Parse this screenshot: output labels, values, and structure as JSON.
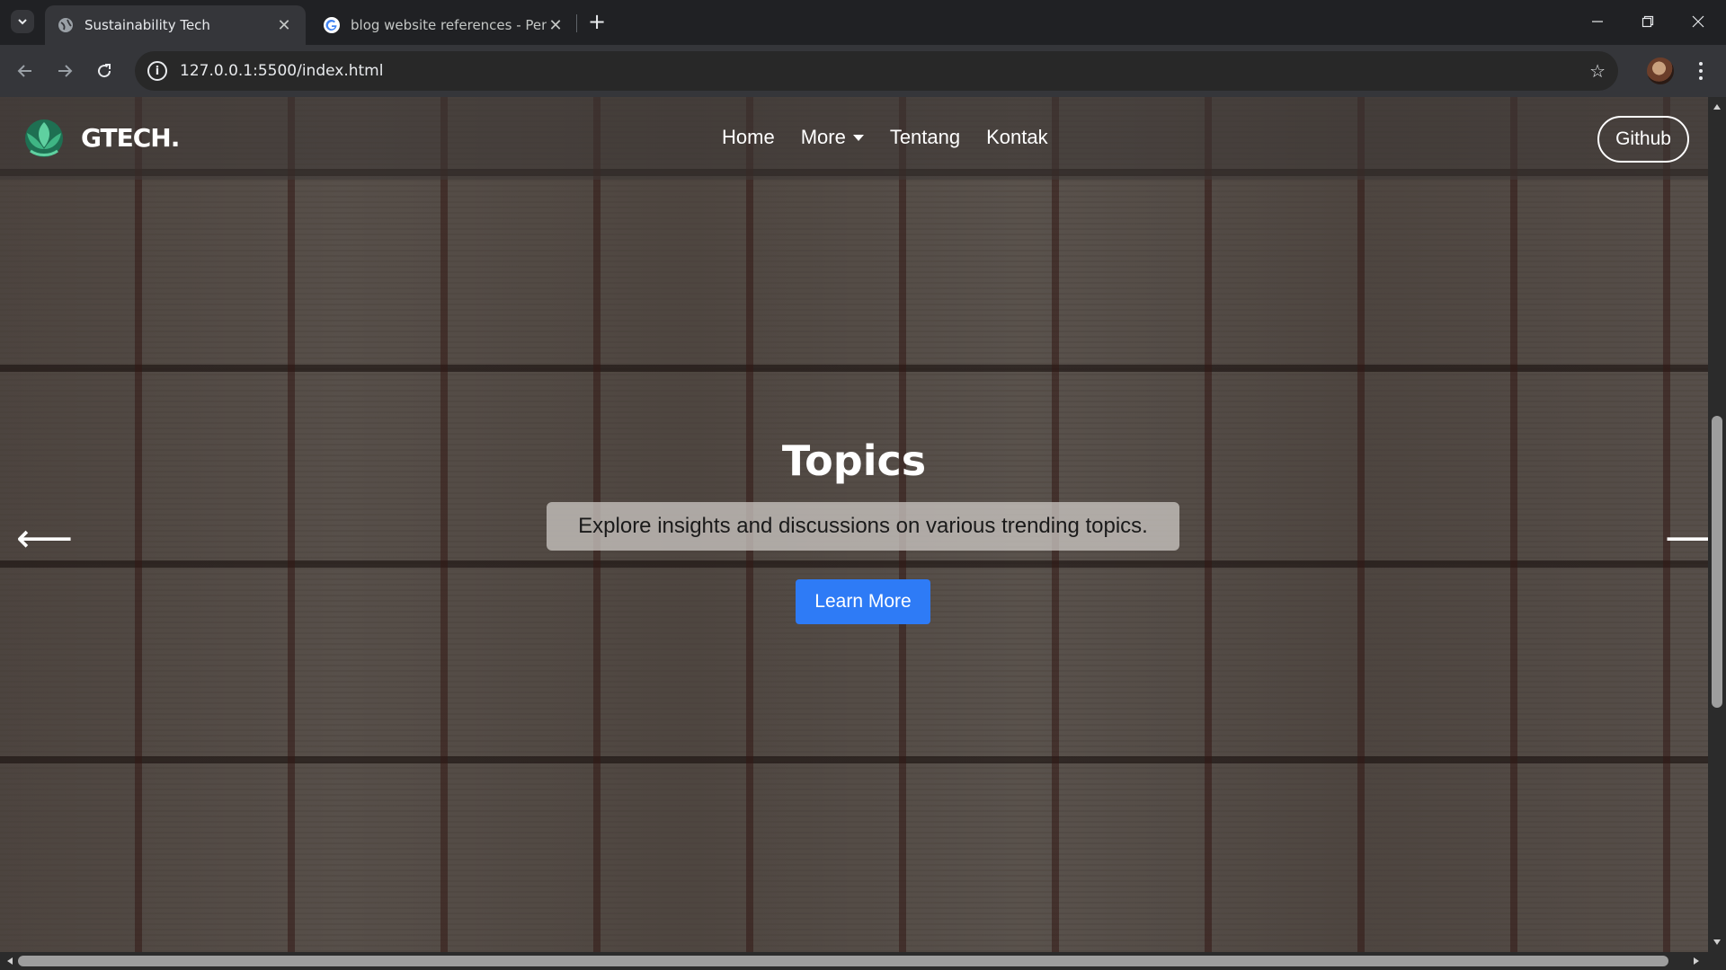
{
  "browser": {
    "tabs": [
      {
        "title": "Sustainability Tech",
        "active": true,
        "favicon": "globe-icon"
      },
      {
        "title": "blog website references - Penel",
        "active": false,
        "favicon": "google-icon"
      }
    ],
    "url": "127.0.0.1:5500/index.html",
    "icons": {
      "tab_list": "chevron-down-icon",
      "new_tab": "plus-icon",
      "back": "arrow-left-icon",
      "forward": "arrow-right-icon",
      "reload": "reload-icon",
      "site_info": "info-icon",
      "bookmark": "star-icon",
      "menu": "kebab-icon"
    }
  },
  "site": {
    "logo_text": "GTECH.",
    "nav": [
      {
        "label": "Home"
      },
      {
        "label": "More",
        "has_dropdown": true
      },
      {
        "label": "Tentang"
      },
      {
        "label": "Kontak"
      }
    ],
    "github_label": "Github",
    "hero": {
      "title": "Topics",
      "subtitle": "Explore insights and discussions on various trending topics.",
      "cta_label": "Learn More",
      "prev_arrow": "⟵",
      "next_arrow": "⟶"
    }
  },
  "colors": {
    "chrome_bg": "#202124",
    "toolbar_bg": "#35363a",
    "accent_button": "#2e7bf6",
    "logo_green": "#2f9c6e"
  }
}
